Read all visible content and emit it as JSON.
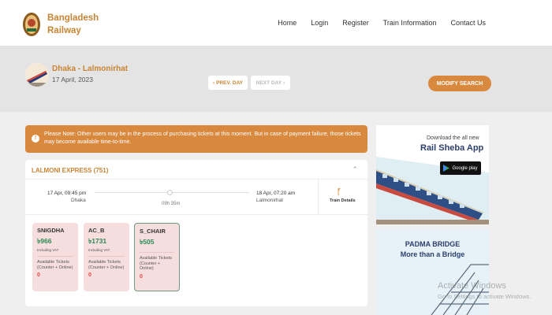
{
  "brand": {
    "line1": "Bangladesh",
    "line2": "Railway"
  },
  "nav": [
    "Home",
    "Login",
    "Register",
    "Train Information",
    "Contact Us"
  ],
  "journey": {
    "route": "Dhaka - Lalmonirhat",
    "date": "17 April, 2023",
    "prev_day": "PREV. DAY",
    "next_day": "NEXT DAY",
    "modify": "MODIFY SEARCH"
  },
  "notice": "Please Note: Other users may be in the process of purchasing tickets at this moment. But in case of payment failure, those tickets may become available time-to-time.",
  "train": {
    "name": "LALMONI EXPRESS (751)",
    "departure_time": "17 Apr, 09:45 pm",
    "departure_station": "Dhaka",
    "arrival_time": "18 Apr, 07:20 am",
    "arrival_station": "Lalmonirhat",
    "duration": "09h 35m",
    "details_label": "Train Details",
    "seats": [
      {
        "class": "SNIGDHA",
        "fare": "৳966",
        "vat": "Including VAT",
        "avail_label": "Available Tickets (Counter + Online)",
        "count": "0",
        "selected": false
      },
      {
        "class": "AC_B",
        "fare": "৳1731",
        "vat": "Including VAT",
        "avail_label": "Available Tickets (Counter + Online)",
        "count": "0",
        "selected": false
      },
      {
        "class": "S_CHAIR",
        "fare": "৳505",
        "vat": "",
        "avail_label": "Available Tickets (Counter + Online)",
        "count": "0",
        "selected": true
      }
    ]
  },
  "ads": {
    "app_download": "Download the all new",
    "app_name": "Rail Sheba App",
    "google_play": "Google play",
    "padma_line1": "PADMA BRIDGE",
    "padma_line2": "More than a Bridge"
  },
  "watermark": {
    "line1": "Activate Windows",
    "line2": "Go to Settings to activate Windows."
  },
  "colors": {
    "brand": "#c98433",
    "accent": "#d9893e",
    "fare": "#2b8a57",
    "count": "#e54646"
  }
}
